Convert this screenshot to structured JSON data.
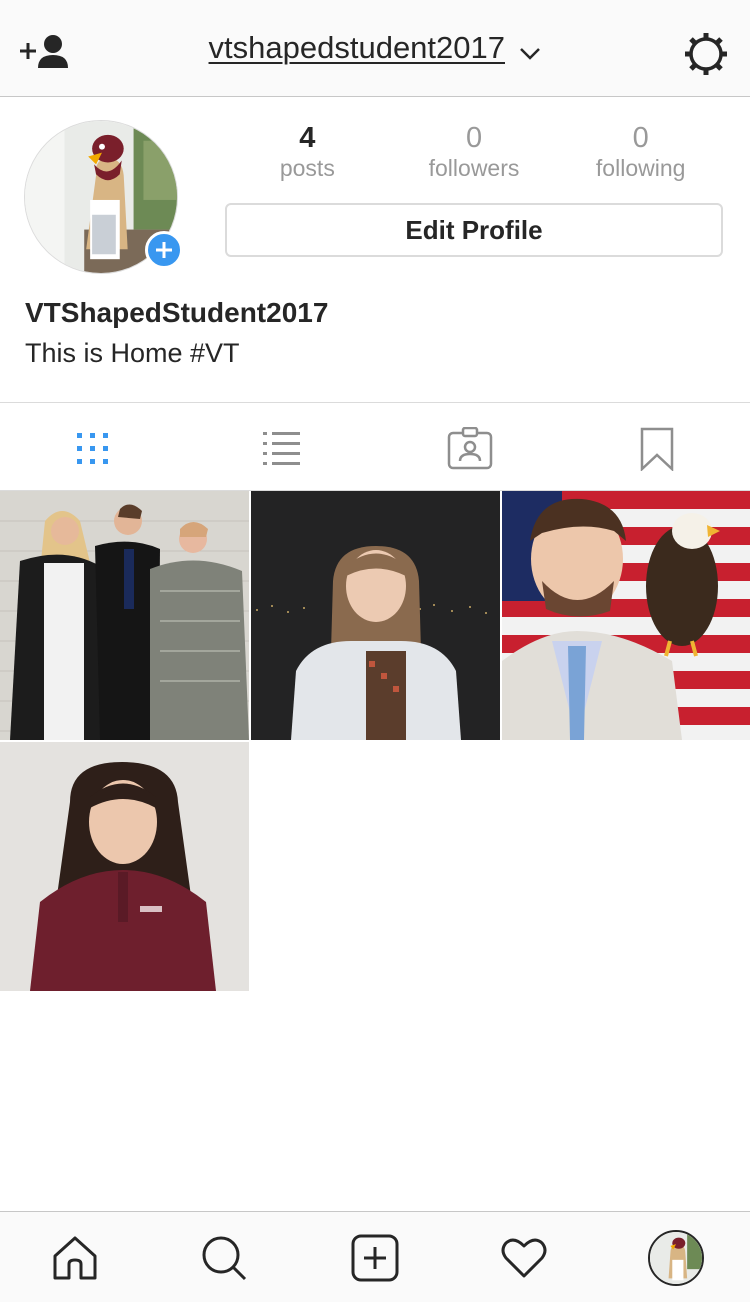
{
  "header": {
    "username": "vtshapedstudent2017",
    "add_person_icon": "add-person-icon",
    "dropdown_icon": "chevron-down-icon",
    "settings_icon": "gear-icon"
  },
  "profile": {
    "stats": [
      {
        "value": "4",
        "label": "posts"
      },
      {
        "value": "0",
        "label": "followers"
      },
      {
        "value": "0",
        "label": "following"
      }
    ],
    "edit_button_label": "Edit Profile",
    "full_name": "VTShapedStudent2017",
    "bio": "This is Home #VT",
    "accent_color": "#3897f0"
  },
  "tabs": [
    {
      "icon": "grid-icon",
      "active": true
    },
    {
      "icon": "list-icon",
      "active": false
    },
    {
      "icon": "tagged-icon",
      "active": false
    },
    {
      "icon": "bookmark-icon",
      "active": false
    }
  ],
  "posts": [
    {
      "subject": "family-photo"
    },
    {
      "subject": "night-portrait"
    },
    {
      "subject": "eagle-flag-portrait"
    },
    {
      "subject": "maroon-quarterzip-portrait"
    }
  ],
  "bottom_nav": [
    {
      "icon": "home-icon"
    },
    {
      "icon": "search-icon"
    },
    {
      "icon": "add-post-icon"
    },
    {
      "icon": "heart-icon"
    },
    {
      "icon": "profile-avatar-icon"
    }
  ]
}
